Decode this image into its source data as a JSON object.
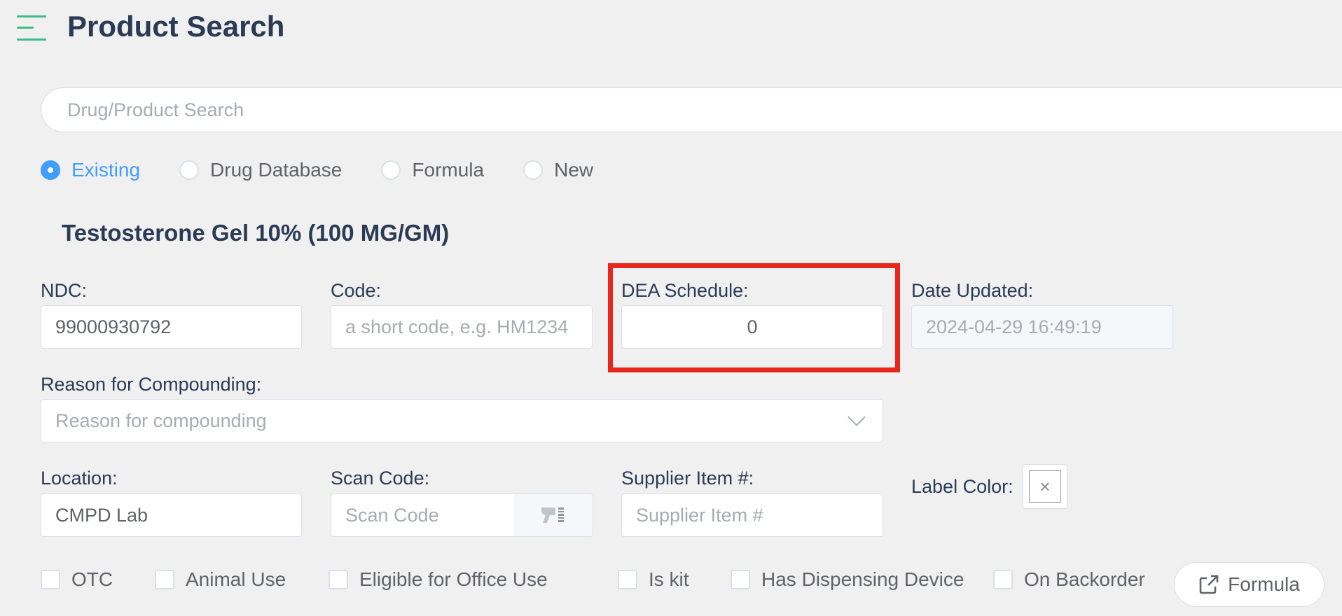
{
  "header": {
    "title": "Product Search"
  },
  "search": {
    "placeholder": "Drug/Product Search"
  },
  "source_options": [
    {
      "label": "Existing",
      "selected": true
    },
    {
      "label": "Drug Database",
      "selected": false
    },
    {
      "label": "Formula",
      "selected": false
    },
    {
      "label": "New",
      "selected": false
    }
  ],
  "product": {
    "name": "Testosterone Gel 10% (100 MG/GM)"
  },
  "fields": {
    "ndc": {
      "label": "NDC:",
      "value": "99000930792"
    },
    "code": {
      "label": "Code:",
      "placeholder": "a short code, e.g. HM1234"
    },
    "dea_schedule": {
      "label": "DEA Schedule:",
      "value": "0"
    },
    "date_updated": {
      "label": "Date Updated:",
      "value": "2024-04-29 16:49:19"
    },
    "reason": {
      "label": "Reason for Compounding:",
      "placeholder": "Reason for compounding"
    },
    "location": {
      "label": "Location:",
      "value": "CMPD Lab"
    },
    "scan_code": {
      "label": "Scan Code:",
      "placeholder": "Scan Code"
    },
    "supplier_item": {
      "label": "Supplier Item #:",
      "placeholder": "Supplier Item #"
    },
    "label_color": {
      "label": "Label Color:"
    }
  },
  "checkboxes": [
    {
      "label": "OTC",
      "checked": false
    },
    {
      "label": "Animal Use",
      "checked": false
    },
    {
      "label": "Eligible for Office Use",
      "checked": false
    },
    {
      "label": "Is kit",
      "checked": false
    },
    {
      "label": "Has Dispensing Device",
      "checked": false
    },
    {
      "label": "On Backorder",
      "checked": false
    }
  ],
  "buttons": {
    "formula": "Formula"
  },
  "colors": {
    "accent": "#409eff",
    "menu_icon": "#3dbb8a",
    "highlight": "#e8261c",
    "title": "#2b3a55"
  }
}
